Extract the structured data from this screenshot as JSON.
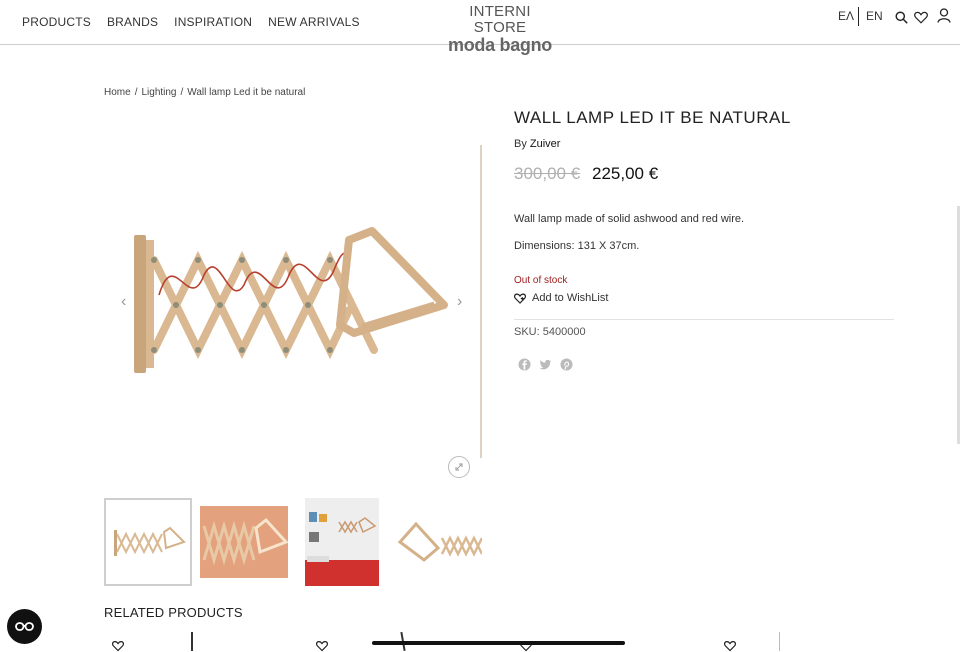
{
  "header": {
    "nav": [
      "PRODUCTS",
      "BRANDS",
      "INSPIRATION",
      "NEW ARRIVALS"
    ],
    "logo_line1": "INTERNI STORE",
    "logo_line2": "moda bagno",
    "lang_el": "ΕΛ",
    "lang_en": "EN"
  },
  "breadcrumb": {
    "home": "Home",
    "category": "Lighting",
    "current": "Wall lamp Led it be natural",
    "separator": "/"
  },
  "product": {
    "title": "WALL LAMP LED IT BE NATURAL",
    "by_label": "By",
    "brand": "Zuiver",
    "old_price": "300,00 €",
    "price": "225,00 €",
    "description": "Wall lamp made of solid ashwood and red wire.",
    "dimensions": "Dimensions:  131 X 37cm.",
    "stock": "Out of stock",
    "wishlist": "Add to WishList",
    "sku_label": "SKU:",
    "sku": "5400000"
  },
  "related_title": "RELATED PRODUCTS",
  "colors": {
    "wood": "#d9b892",
    "wire": "#b8402e",
    "stock": "#a02020"
  }
}
